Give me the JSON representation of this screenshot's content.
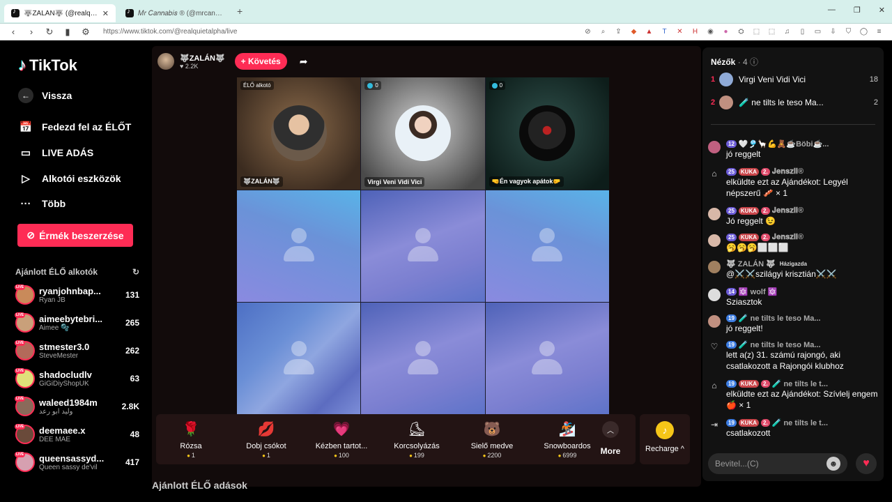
{
  "browser": {
    "tabs": [
      {
        "title": "🐺ZALÁN🐺 (@realquietalp",
        "active": true
      },
      {
        "title": "𝑀𝑟 𝐶𝑎𝑛𝑛𝑎𝑏𝑖𝑠 ® (@mrcannabis_",
        "active": false
      }
    ],
    "url": "https://www.tiktok.com/@realquietalpha/live"
  },
  "sidebar": {
    "logo": "TikTok",
    "back": "Vissza",
    "nav": [
      {
        "label": "Fedezd fel az ÉLŐT",
        "icon": "calendar-icon"
      },
      {
        "label": "LIVE ADÁS",
        "icon": "camera-icon"
      },
      {
        "label": "Alkotói eszközök",
        "icon": "play-circle-icon"
      },
      {
        "label": "Több",
        "icon": "more-icon"
      }
    ],
    "coins_button": "Érmék beszerzése",
    "recommended_heading": "Ajánlott ÉLŐ alkotók",
    "creators": [
      {
        "username": "ryanjohnbap...",
        "name": "Ryan JB",
        "count": "131",
        "color": "#c98a5a"
      },
      {
        "username": "aimeebytebri...",
        "name": "Aimee 🫧",
        "count": "265",
        "color": "#c9a07a"
      },
      {
        "username": "stmester3.0",
        "name": "SteveMester",
        "count": "262",
        "color": "#b36a5a"
      },
      {
        "username": "shadocludlv",
        "name": "GiGiDiyShopUK",
        "count": "63",
        "color": "#e0e07a"
      },
      {
        "username": "waleed1984m",
        "name": "وليد ابو رعد",
        "count": "2.8K",
        "color": "#8a6a5a"
      },
      {
        "username": "deemaee.x",
        "name": "DEE MAE",
        "count": "48",
        "color": "#6a4a3a"
      },
      {
        "username": "queensassyd...",
        "name": "Queen sassy de'vil",
        "count": "417",
        "color": "#d6a0b0"
      }
    ]
  },
  "stream": {
    "host_name": "🐺ZALÁN🐺",
    "host_likes": "♥ 2.2K",
    "follow_button": "+ Követés",
    "guests": [
      {
        "badge": "ÉLŐ alkotó",
        "name": "🐺ZALÁN🐺"
      },
      {
        "badge": "0",
        "name": "Virgi Veni Vidi Vici"
      },
      {
        "badge": "0",
        "name": "🤜Én vagyok apátok🤛"
      }
    ],
    "gifts": [
      {
        "name": "Rózsa",
        "price": "1",
        "icon": "🌹"
      },
      {
        "name": "Dobj csókot",
        "price": "1",
        "icon": "💋"
      },
      {
        "name": "Kézben tartot...",
        "price": "100",
        "icon": "💗"
      },
      {
        "name": "Korcsolyázás",
        "price": "199",
        "icon": "⛸"
      },
      {
        "name": "Sielő medve",
        "price": "2200",
        "icon": "🐻"
      },
      {
        "name": "Snowboardos",
        "price": "6999",
        "icon": "🏂"
      }
    ],
    "more_label": "More",
    "recharge_label": "Recharge ^",
    "recommended_live": "Ajánlott ÉLŐ adások"
  },
  "chat": {
    "viewers_label": "Nézők",
    "viewers_count": "· 4",
    "viewers": [
      {
        "rank": "",
        "name": "Virgi Veni Vidi Vici",
        "count": "18"
      },
      {
        "rank": "2",
        "name": "🧪 ne tilts le teso Ma...",
        "count": "2"
      }
    ],
    "messages": [
      {
        "type": "user",
        "badges": [
          "12"
        ],
        "name": "🤍🎐🦙💪🧸☕Böbi☕...",
        "text": "jó reggelt",
        "color": "#c06080"
      },
      {
        "type": "gift",
        "badges": [
          "25",
          "KUKA",
          "2."
        ],
        "name": "𝐉𝐞𝐧𝐬𝐳𝐢𝐢®",
        "text": "elküldte ezt az Ajándékot: Legyél népszerű 🥓 × 1"
      },
      {
        "type": "user",
        "badges": [
          "25",
          "KUKA",
          "2."
        ],
        "name": "𝐉𝐞𝐧𝐬𝐳𝐢𝐢®",
        "text": "Jó reggelt 😉",
        "color": "#d8b8a8"
      },
      {
        "type": "user",
        "badges": [
          "25",
          "KUKA",
          "2."
        ],
        "name": "𝐉𝐞𝐧𝐬𝐳𝐢𝐢®",
        "text": "🥱🥱🥱⬜⬜⬜",
        "color": "#d8b8a8"
      },
      {
        "type": "user",
        "badges": [
          "Házigazda"
        ],
        "name": "🐺 ZALÁN 🐺",
        "text": "@⚔️⚔️szilágyi krisztián⚔️⚔️",
        "color": "#a08060"
      },
      {
        "type": "user",
        "badges": [
          "14"
        ],
        "name": "🔯 wolf 🔯",
        "text": "Sziasztok",
        "color": "#dddddd"
      },
      {
        "type": "user",
        "badges": [
          "19"
        ],
        "name": "🧪 ne tilts le teso Ma...",
        "text": "jó reggelt!",
        "color": "#c09080"
      },
      {
        "type": "fan",
        "badges": [
          "19"
        ],
        "name": "🧪 ne tilts le teso Ma...",
        "text": "lett a(z) 31. számú rajongó, aki csatlakozott a Rajongói klubhoz"
      },
      {
        "type": "gift",
        "badges": [
          "19",
          "KUKA",
          "2."
        ],
        "name": "🧪 ne tilts le t...",
        "text": "elküldte ezt az Ajándékot: Szívlelj engem 🍎 × 1"
      },
      {
        "type": "join",
        "badges": [
          "19",
          "KUKA",
          "2."
        ],
        "name": "🧪 ne tilts le t...",
        "text": "csatlakozott"
      }
    ],
    "input_placeholder": "Bevitel...(C)"
  }
}
